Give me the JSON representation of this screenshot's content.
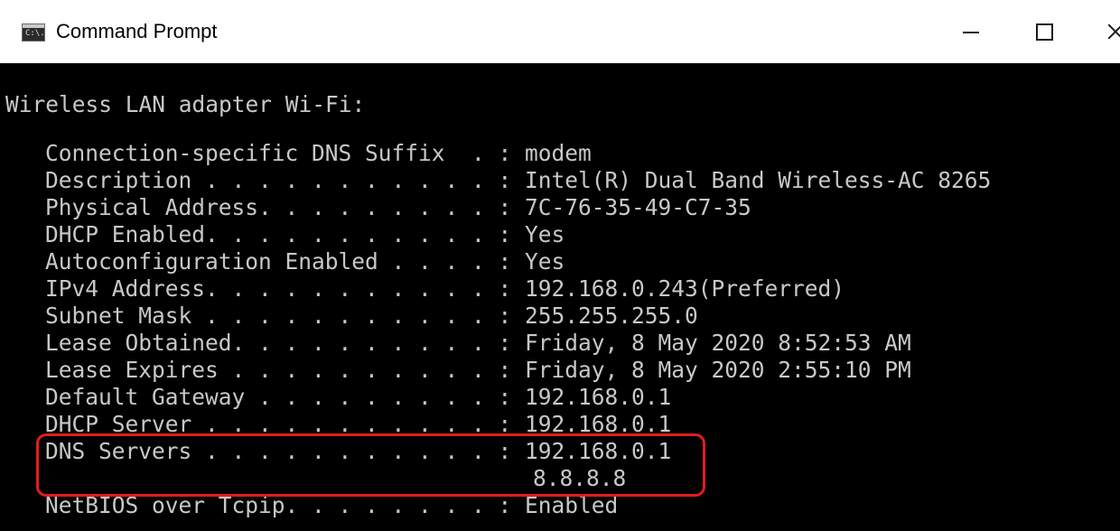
{
  "window": {
    "title": "Command Prompt",
    "icon_text": "C:\\."
  },
  "console": {
    "adapter_header": "Wireless LAN adapter Wi-Fi:",
    "entries": [
      {
        "text": "Connection-specific DNS Suffix  . : modem"
      },
      {
        "text": "Description . . . . . . . . . . . : Intel(R) Dual Band Wireless-AC 8265"
      },
      {
        "text": "Physical Address. . . . . . . . . : 7C-76-35-49-C7-35"
      },
      {
        "text": "DHCP Enabled. . . . . . . . . . . : Yes"
      },
      {
        "text": "Autoconfiguration Enabled . . . . : Yes"
      },
      {
        "text": "IPv4 Address. . . . . . . . . . . : 192.168.0.243(Preferred)"
      },
      {
        "text": "Subnet Mask . . . . . . . . . . . : 255.255.255.0"
      },
      {
        "text": "Lease Obtained. . . . . . . . . . : Friday, 8 May 2020 8:52:53 AM"
      },
      {
        "text": "Lease Expires . . . . . . . . . . : Friday, 8 May 2020 2:55:10 PM"
      },
      {
        "text": "Default Gateway . . . . . . . . . : 192.168.0.1"
      },
      {
        "text": "DHCP Server . . . . . . . . . . . : 192.168.0.1"
      },
      {
        "text": "DNS Servers . . . . . . . . . . . : 192.168.0.1"
      },
      {
        "text": "8.8.8.8"
      },
      {
        "text": "NetBIOS over Tcpip. . . . . . . . : Enabled"
      }
    ]
  },
  "colors": {
    "console_bg": "#000000",
    "console_text": "#c8c8c8",
    "titlebar_bg": "#ffffff",
    "highlight": "#e11d1d"
  }
}
